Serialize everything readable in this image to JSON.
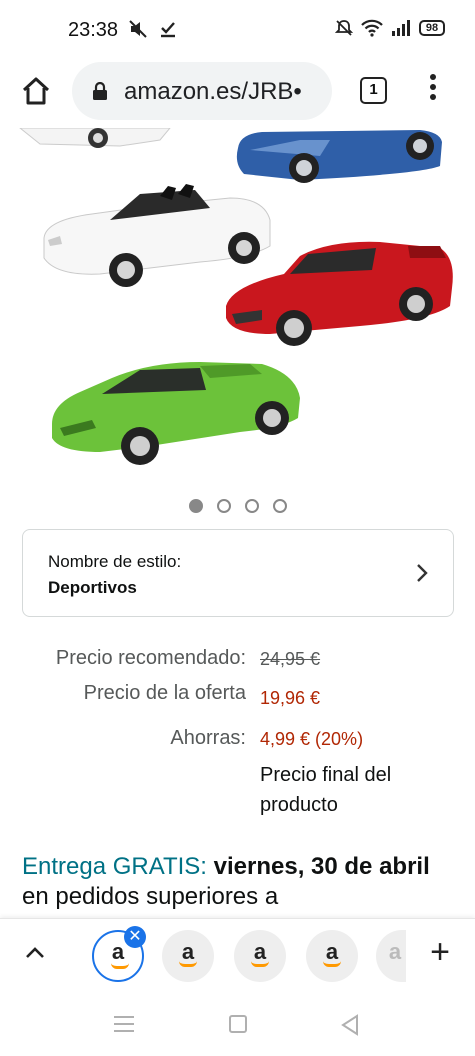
{
  "status_bar": {
    "time": "23:38",
    "battery": "98"
  },
  "browser": {
    "url": "amazon.es/JRB•",
    "tab_count": "1"
  },
  "gallery": {
    "image_count": 4,
    "active_index": 0,
    "car_colors": [
      "#2f5fa8",
      "#f2f2f2",
      "#c9171e",
      "#6cc23a"
    ]
  },
  "style_selector": {
    "label": "Nombre de estilo:",
    "value": "Deportivos"
  },
  "pricing": {
    "recommended_label": "Precio recomendado:",
    "recommended_value": "24,95 €",
    "offer_label": "Precio de la oferta",
    "offer_value": "19,96 €",
    "savings_label": "Ahorras:",
    "savings_value": "4,99 € (20%)",
    "final_note": "Precio final del producto"
  },
  "delivery": {
    "free_label": "Entrega GRATIS:",
    "date": "viernes, 30 de abril",
    "condition": "en pedidos superiores a"
  },
  "tab_strip": {
    "tab_letter": "a",
    "accent_color": "#1a73e8",
    "smile_color": "#ff9900"
  },
  "colors": {
    "price_red": "#b12704",
    "link_teal": "#007185"
  }
}
